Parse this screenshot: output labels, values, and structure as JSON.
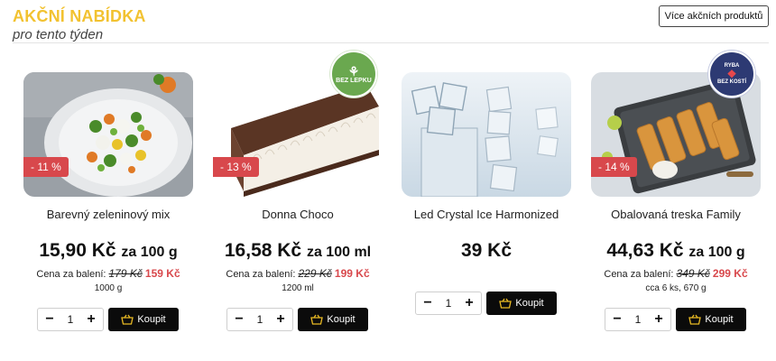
{
  "header": {
    "title": "AKČNÍ NABÍDKA",
    "subtitle": "pro tento týden",
    "more_button": "Více akčních produktů"
  },
  "colors": {
    "title": "#f2c230",
    "discount_badge": "#d8484c",
    "buy_button": "#0b0b0b"
  },
  "products": [
    {
      "name": "Barevný zeleninový mix",
      "discount": "- 11 %",
      "price": "15,90 Kč",
      "unit": "za 100 g",
      "pack_label": "Cena za balení:",
      "old_price": "179 Kč",
      "new_price": "159 Kč",
      "weight": "1000 g",
      "quantity": "1",
      "buy_label": "Koupit"
    },
    {
      "name": "Donna Choco",
      "discount": "- 13 %",
      "price": "16,58 Kč",
      "unit": "za 100 ml",
      "pack_label": "Cena za balení:",
      "old_price": "229 Kč",
      "new_price": "199 Kč",
      "weight": "1200 ml",
      "quantity": "1",
      "buy_label": "Koupit",
      "badge": "BEZ LEPKU"
    },
    {
      "name": "Led Crystal Ice Harmonized",
      "price": "39 Kč",
      "quantity": "1",
      "buy_label": "Koupit"
    },
    {
      "name": "Obalovaná treska Family",
      "discount": "- 14 %",
      "price": "44,63 Kč",
      "unit": "za 100 g",
      "pack_label": "Cena za balení:",
      "old_price": "349 Kč",
      "new_price": "299 Kč",
      "weight": "cca 6 ks, 670 g",
      "quantity": "1",
      "buy_label": "Koupit",
      "badge_top": "RYBA",
      "badge_bottom": "BEZ KOSTÍ"
    }
  ]
}
